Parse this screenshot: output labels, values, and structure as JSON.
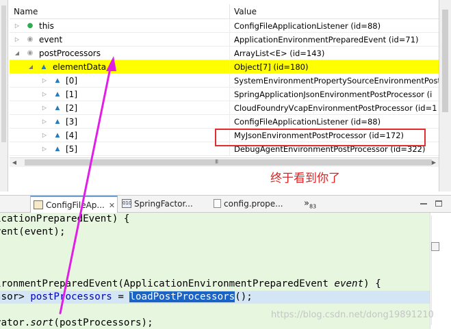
{
  "variables": {
    "columns": {
      "name": "Name",
      "value": "Value"
    },
    "rows": [
      {
        "name": "this",
        "value": "ConfigFileApplicationListener  (id=88)"
      },
      {
        "name": "event",
        "value": "ApplicationEnvironmentPreparedEvent  (id=71)"
      },
      {
        "name": "postProcessors",
        "value": "ArrayList<E>  (id=143)"
      },
      {
        "name": "elementData",
        "value": "Object[7]  (id=180)"
      },
      {
        "name": "[0]",
        "value": "SystemEnvironmentPropertySourceEnvironmentPost"
      },
      {
        "name": "[1]",
        "value": "SpringApplicationJsonEnvironmentPostProcessor  (i"
      },
      {
        "name": "[2]",
        "value": "CloudFoundryVcapEnvironmentPostProcessor  (id=1"
      },
      {
        "name": "[3]",
        "value": "ConfigFileApplicationListener  (id=88)"
      },
      {
        "name": "[4]",
        "value": "MyJsonEnvironmentPostProcessor  (id=172)"
      },
      {
        "name": "[5]",
        "value": "DebugAgentEnvironmentPostProcessor  (id=322)"
      }
    ],
    "hscroll_grip": "III"
  },
  "annotation": {
    "text": "终于看到你了",
    "color": "#e02020"
  },
  "editor": {
    "tabs": [
      {
        "label": "ConfigFileAp...",
        "close": "✕"
      },
      {
        "label": "SpringFactor..."
      },
      {
        "label": "config.prope..."
      }
    ],
    "more_tabs": {
      "glyph": "»",
      "count": "83"
    },
    "lines": [
      {
        "seg": [
          "icationPreparedEvent) {"
        ]
      },
      {
        "seg": [
          "vent(event);"
        ]
      },
      {
        "seg": [
          ""
        ]
      },
      {
        "seg": [
          ""
        ]
      },
      {
        "seg": [
          ""
        ]
      },
      {
        "seg": [
          "ironmentPreparedEvent(ApplicationEnvironmentPreparedEvent ",
          "event",
          ") {"
        ]
      },
      {
        "seg": [
          "ssor> ",
          "postProcessors",
          " = ",
          "loadPostProcessors",
          "();"
        ]
      },
      {
        "seg": [
          ""
        ]
      },
      {
        "seg": [
          "rator.",
          "sort",
          "(postProcessors);"
        ]
      }
    ]
  },
  "watermark": "https://blog.csdn.net/dong19891210",
  "colors": {
    "selection_row": "#ffff00",
    "editor_bg": "#e7f6df",
    "current_line": "#d4e6f5",
    "selected_identifier": "#1c63c6",
    "arrow": "#e11ee6",
    "annotation_box": "#e02d2d"
  }
}
